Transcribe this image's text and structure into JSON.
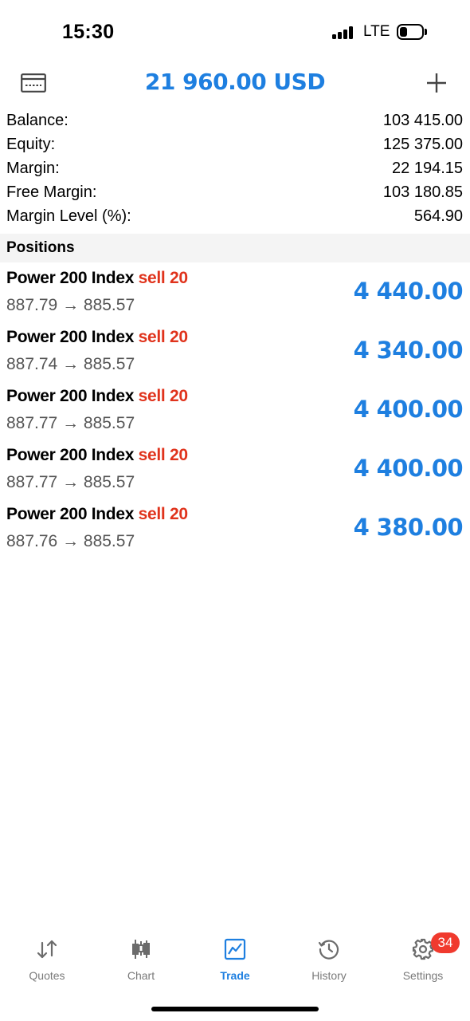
{
  "status_bar": {
    "time": "15:30",
    "network": "LTE"
  },
  "header": {
    "title": "21 960.00 USD"
  },
  "account": [
    {
      "label": "Balance:",
      "value": "103 415.00"
    },
    {
      "label": "Equity:",
      "value": "125 375.00"
    },
    {
      "label": "Margin:",
      "value": "22 194.15"
    },
    {
      "label": "Free Margin:",
      "value": "103 180.85"
    },
    {
      "label": "Margin Level (%):",
      "value": "564.90"
    }
  ],
  "positions": {
    "title": "Positions",
    "items": [
      {
        "symbol": "Power 200 Index",
        "direction": "sell 20",
        "prices": "887.79 → 885.57",
        "profit": "4 440.00"
      },
      {
        "symbol": "Power 200 Index",
        "direction": "sell 20",
        "prices": "887.74 → 885.57",
        "profit": "4 340.00"
      },
      {
        "symbol": "Power 200 Index",
        "direction": "sell 20",
        "prices": "887.77 → 885.57",
        "profit": "4 400.00"
      },
      {
        "symbol": "Power 200 Index",
        "direction": "sell 20",
        "prices": "887.77 → 885.57",
        "profit": "4 400.00"
      },
      {
        "symbol": "Power 200 Index",
        "direction": "sell 20",
        "prices": "887.76 → 885.57",
        "profit": "4 380.00"
      }
    ]
  },
  "tabs": [
    {
      "label": "Quotes",
      "icon": "quotes-icon"
    },
    {
      "label": "Chart",
      "icon": "chart-icon"
    },
    {
      "label": "Trade",
      "icon": "trade-icon",
      "active": true
    },
    {
      "label": "History",
      "icon": "history-icon"
    },
    {
      "label": "Settings",
      "icon": "settings-icon"
    }
  ],
  "settings_badge": "34",
  "colors": {
    "accent": "#1e7fe0",
    "sell": "#e0331c",
    "badge": "#f03a2e"
  }
}
